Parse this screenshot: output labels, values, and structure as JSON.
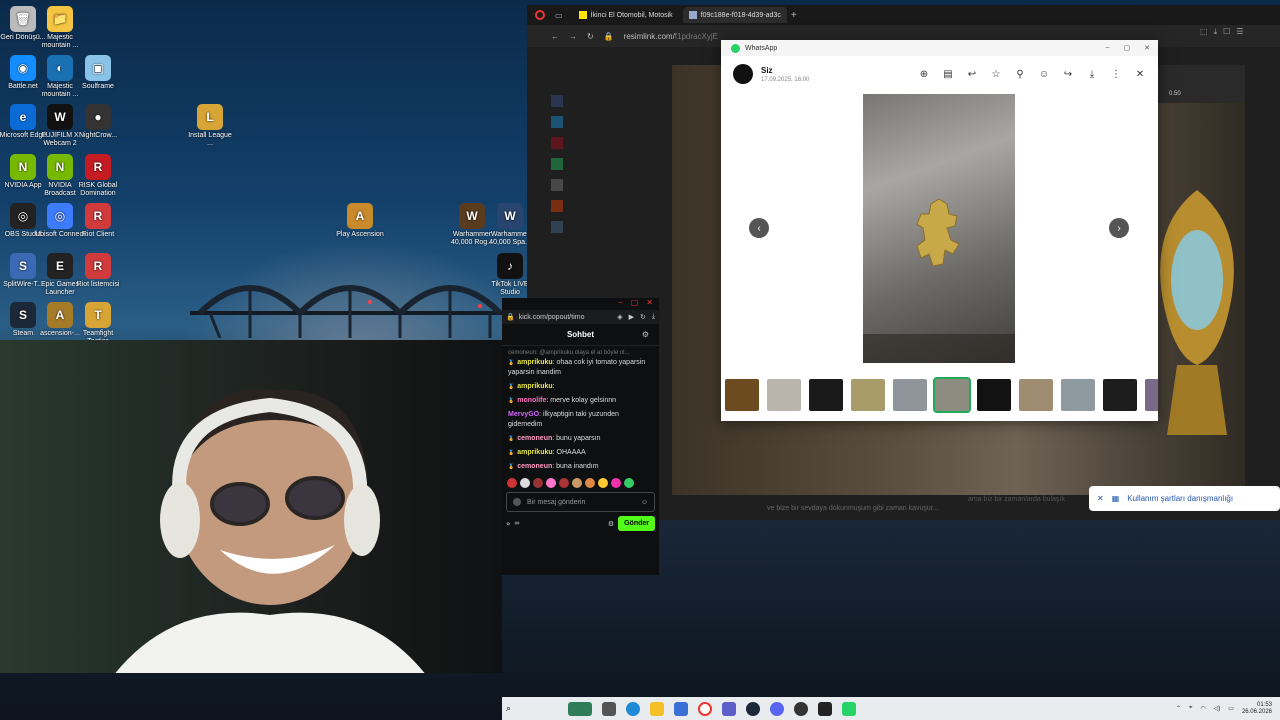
{
  "desktop_icons": [
    {
      "label": "Geri Dönüşü...",
      "glyph": "🗑"
    },
    {
      "label": "Majestic mountain ...",
      "glyph": "📁"
    },
    {
      "label": "Battle.net",
      "glyph": "◉"
    },
    {
      "label": "Majestic mountain ...",
      "glyph": "◐"
    },
    {
      "label": "Soulframe",
      "glyph": "▣"
    },
    {
      "label": "Microsoft Edge",
      "glyph": "e"
    },
    {
      "label": "FUJIFILM X Webcam 2",
      "glyph": "W"
    },
    {
      "label": "NightCrow...",
      "glyph": "●"
    },
    {
      "label": "Install League ...",
      "glyph": "L"
    },
    {
      "label": "NVIDIA App",
      "glyph": "N"
    },
    {
      "label": "NVIDIA Broadcast",
      "glyph": "N"
    },
    {
      "label": "RISK Global Domination",
      "glyph": "R"
    },
    {
      "label": "OBS Studio",
      "glyph": "◎"
    },
    {
      "label": "Ubisoft Connect",
      "glyph": "◎"
    },
    {
      "label": "Riot Client",
      "glyph": "R"
    },
    {
      "label": "Play Ascension",
      "glyph": "A"
    },
    {
      "label": "Warhammer 40,000 Rog...",
      "glyph": "W"
    },
    {
      "label": "Warhammer 40,000 Spa...",
      "glyph": "W"
    },
    {
      "label": "SplitWire-T...",
      "glyph": "S"
    },
    {
      "label": "Epic Games Launcher",
      "glyph": "E"
    },
    {
      "label": "Riot listemcisi",
      "glyph": "R"
    },
    {
      "label": "TikTok LIVE Studio",
      "glyph": "♪"
    },
    {
      "label": "Steam",
      "glyph": "S"
    },
    {
      "label": "ascension-...",
      "glyph": "A"
    },
    {
      "label": "Teamfight Tactics",
      "glyph": "T"
    }
  ],
  "browser": {
    "tabs": [
      {
        "label": "İkinci El Otomobil, Motosik"
      },
      {
        "label": "f09c188e-f018-4d39-ad3c"
      }
    ],
    "new_tab": "+",
    "url": "resimlink.com/",
    "url_rest": "f1pdracXyjE"
  },
  "whatsapp": {
    "app_title": "WhatsApp",
    "sender": "Siz",
    "timestamp": "17.09.2025, 16:00",
    "thumb_count": 12
  },
  "kick": {
    "url": "kick.com/popout/timo",
    "panel_title": "Sohbet",
    "reply_hint": "cemoneun: @amprikuku olaya el at böyle ol...",
    "messages": [
      {
        "user": "amprikuku",
        "color": "#e7e64b",
        "badge": "🏅",
        "text": ": ohaa cok iyi tomato yaparsin yaparsin inandim"
      },
      {
        "user": "amprikuku",
        "color": "#e7e64b",
        "badge": "🏅",
        "text": ":"
      },
      {
        "user": "monolife",
        "color": "#ff6fc2",
        "badge": "🏅",
        "text": ": merve kolay gelsinnn"
      },
      {
        "user": "MervyGO",
        "color": "#d466ff",
        "badge": "",
        "text": ": ilkyaptigin taki yuzunden gidemedim"
      },
      {
        "user": "cemoneun",
        "color": "#ff9bc5",
        "badge": "🏅",
        "text": ": bunu yaparsın"
      },
      {
        "user": "amprikuku",
        "color": "#e7e64b",
        "badge": "🏅",
        "text": ": OHAAAA"
      },
      {
        "user": "cemoneun",
        "color": "#ff9bc5",
        "badge": "🏅",
        "text": ": buna inandım"
      }
    ],
    "input_placeholder": "Bir mesaj gönderin",
    "infinity": "∞",
    "send_label": "Gönder"
  },
  "page_text": {
    "site_tagline": "ama biz bir zamanlarda bulaşık",
    "site_line2": "ve bize bir sevdaya dokunmuşum gibi zaman kavuşur...",
    "side_badge": "0.50"
  },
  "toast": {
    "label": "Kullanım şartları danışmanlığı"
  },
  "taskbar": {
    "time": "01:53",
    "date": "26.06.2026"
  },
  "colors": {
    "kick_green": "#53fc18",
    "wa_green": "#25d366",
    "toast_blue": "#2458b3"
  }
}
